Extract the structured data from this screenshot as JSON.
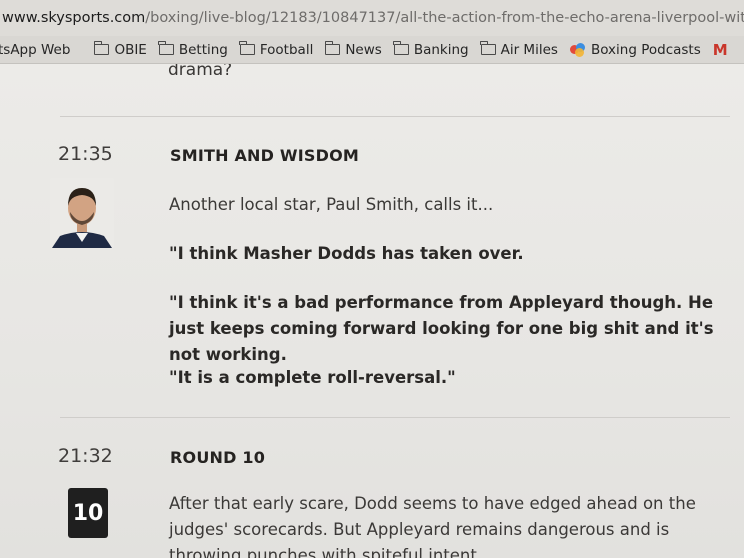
{
  "browser": {
    "url_host": "www.skysports.com",
    "url_path": "/boxing/live-blog/12183/10847137/all-the-action-from-the-echo-arena-liverpool-wit"
  },
  "bookmarks": [
    {
      "label": "tsApp Web",
      "icon": "whatsapp-icon"
    },
    {
      "label": "OBIE",
      "icon": "folder-icon"
    },
    {
      "label": "Betting",
      "icon": "folder-icon"
    },
    {
      "label": "Football",
      "icon": "folder-icon"
    },
    {
      "label": "News",
      "icon": "folder-icon"
    },
    {
      "label": "Banking",
      "icon": "folder-icon"
    },
    {
      "label": "Air Miles",
      "icon": "folder-icon"
    },
    {
      "label": "Boxing Podcasts",
      "icon": "podcast-icon"
    },
    {
      "label": "M",
      "icon": "gmail-icon"
    }
  ],
  "blog": {
    "previous_tail": "drama?",
    "entries": [
      {
        "time": "21:35",
        "headline": "SMITH AND WISDOM",
        "intro": "Another local star, Paul Smith, calls it...",
        "quotes": [
          "\"I think Masher Dodds has taken over.",
          "\"I think it's a bad performance from Appleyard though. He just keeps coming forward looking for one big shit and it's not working.",
          "\"It is a complete roll-reversal.\""
        ]
      },
      {
        "time": "21:32",
        "headline": "ROUND 10",
        "badge": "10",
        "body": "After that early scare, Dodd seems to have edged ahead on the judges' scorecards. But Appleyard remains dangerous and is throwing punches with spiteful intent."
      }
    ]
  }
}
